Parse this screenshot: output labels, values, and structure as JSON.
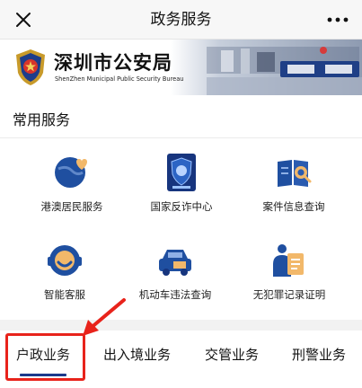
{
  "nav": {
    "title": "政务服务",
    "close_icon": "close-icon",
    "more_icon": "more-icon"
  },
  "banner": {
    "title": "深圳市公安局",
    "subtitle": "ShenZhen Municipal Public Security Bureau"
  },
  "services": {
    "section_title": "常用服务",
    "items": [
      {
        "label": "港澳居民服务",
        "icon": "globe-heart-icon"
      },
      {
        "label": "国家反诈中心",
        "icon": "anti-fraud-badge-icon"
      },
      {
        "label": "案件信息查询",
        "icon": "case-search-icon"
      },
      {
        "label": "智能客服",
        "icon": "smart-service-icon"
      },
      {
        "label": "机动车违法查询",
        "icon": "vehicle-violation-icon"
      },
      {
        "label": "无犯罪记录证明",
        "icon": "no-crime-certificate-icon"
      }
    ]
  },
  "tabs": [
    {
      "label": "户政业务",
      "active": true
    },
    {
      "label": "出入境业务",
      "active": false
    },
    {
      "label": "交管业务",
      "active": false
    },
    {
      "label": "刑警业务",
      "active": false
    }
  ],
  "colors": {
    "accent": "#1b3a8c",
    "annotation": "#e8231b",
    "icon_blue": "#1f4fa0",
    "icon_orange": "#f2b86a"
  }
}
